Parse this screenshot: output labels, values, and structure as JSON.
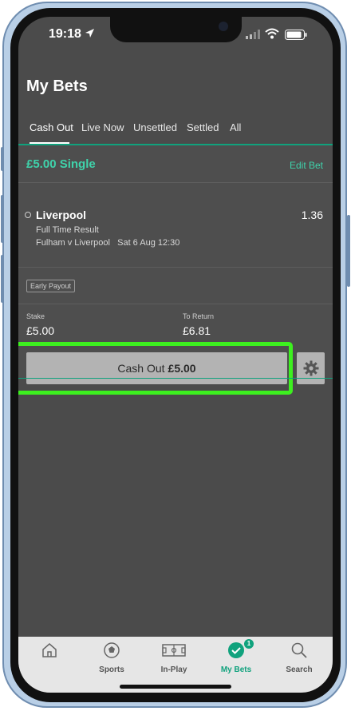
{
  "status_bar": {
    "time": "19:18"
  },
  "page": {
    "title": "My Bets"
  },
  "tabs": [
    {
      "label": "Cash Out",
      "active": true
    },
    {
      "label": "Live Now"
    },
    {
      "label": "Unsettled"
    },
    {
      "label": "Settled"
    },
    {
      "label": "All"
    }
  ],
  "bet": {
    "title": "£5.00 Single",
    "edit_label": "Edit Bet",
    "selection": "Liverpool",
    "odds": "1.36",
    "market": "Full Time Result",
    "event": "Fulham v Liverpool",
    "event_time": "Sat 6 Aug 12:30",
    "badge": "Early Payout",
    "stake_label": "Stake",
    "stake_value": "£5.00",
    "return_label": "To Return",
    "return_value": "£6.81",
    "cashout_label": "Cash Out",
    "cashout_amount": "£5.00"
  },
  "tab_bar": {
    "items": [
      {
        "label": "",
        "icon": "home-icon"
      },
      {
        "label": "Sports",
        "icon": "football-icon"
      },
      {
        "label": "In-Play",
        "icon": "pitch-icon"
      },
      {
        "label": "My Bets",
        "icon": "checkmark-icon",
        "active": true,
        "count": "1"
      },
      {
        "label": "Search",
        "icon": "search-icon"
      }
    ]
  },
  "colors": {
    "accent": "#10a27d",
    "highlight": "#3df01f",
    "background": "#4b4b4b"
  }
}
